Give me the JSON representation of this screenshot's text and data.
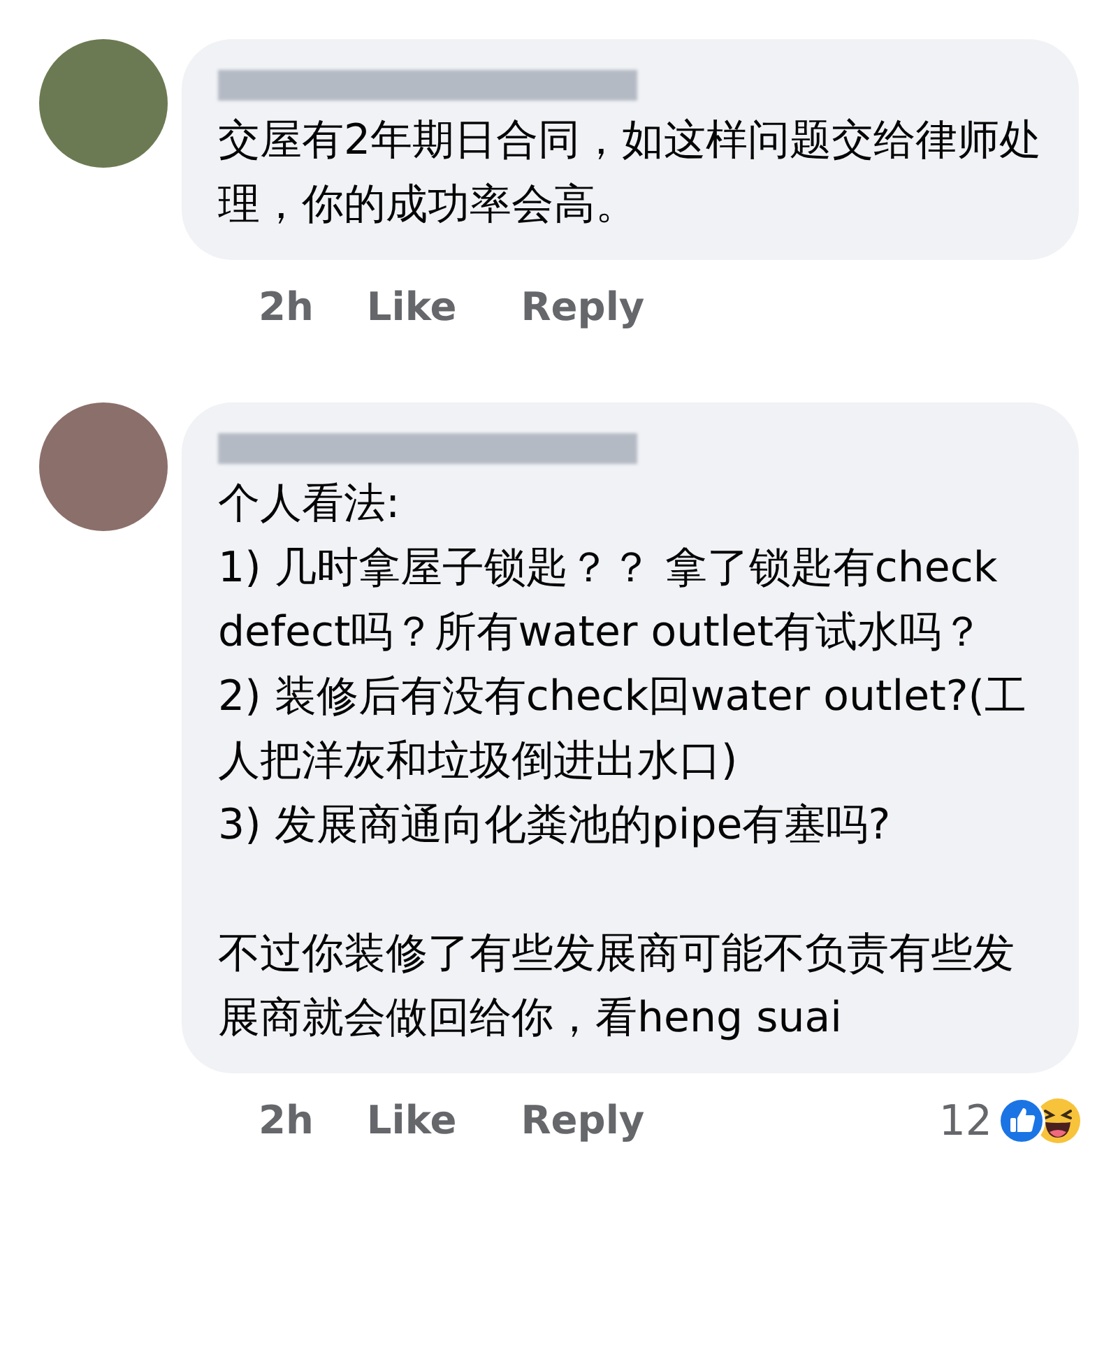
{
  "comments": [
    {
      "paragraphs": [
        [
          "交屋有2年期日合同，如这样问题交给律师处理，你的成功率会高。"
        ]
      ],
      "time": "2h",
      "actions": [
        "Like",
        "Reply"
      ]
    },
    {
      "paragraphs": [
        [
          "个人看法:",
          "1) 几时拿屋子锁匙？？ 拿了锁匙有check defect吗？所有water outlet有试水吗？",
          "2) 装修后有没有check回water outlet?(工人把洋灰和垃圾倒进出水口)",
          "3) 发展商通向化粪池的pipe有塞吗?"
        ],
        [
          "不过你装修了有些发展商可能不负责有些发展商就会做回给你，看heng suai"
        ]
      ],
      "time": "2h",
      "actions": [
        "Like",
        "Reply"
      ],
      "reactions": {
        "count": "12"
      }
    }
  ]
}
